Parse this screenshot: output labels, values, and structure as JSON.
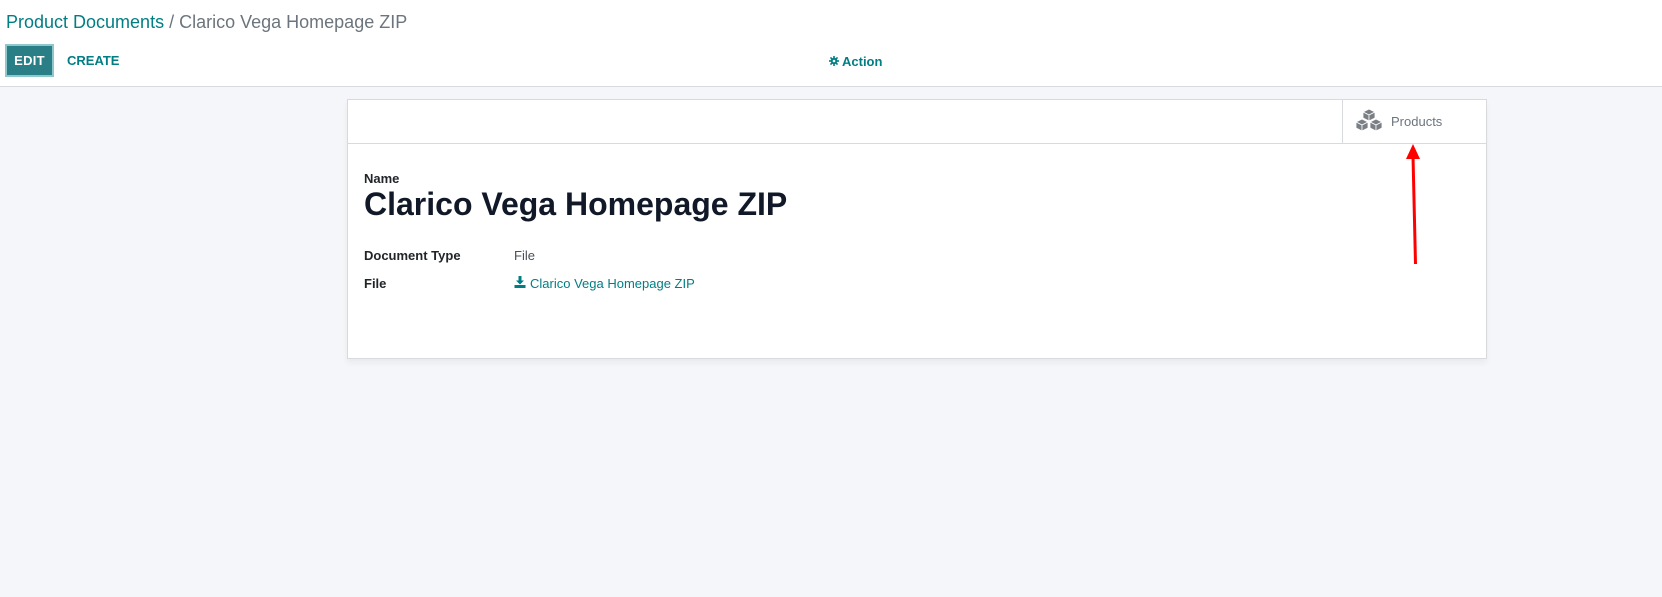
{
  "breadcrumb": {
    "parent": "Product Documents",
    "separator": " / ",
    "current": "Clarico Vega Homepage ZIP"
  },
  "toolbar": {
    "edit_label": "EDIT",
    "create_label": "CREATE",
    "action_label": "Action",
    "action_icon": "gear-icon"
  },
  "smart_button": {
    "label": "Products",
    "icon": "cubes-icon"
  },
  "form": {
    "name_label": "Name",
    "name_value": "Clarico Vega Homepage ZIP",
    "fields": [
      {
        "label": "Document Type",
        "value": "File"
      },
      {
        "label": "File",
        "value": "Clarico Vega Homepage ZIP",
        "icon": "download-icon"
      }
    ]
  },
  "colors": {
    "primary": "#017e84",
    "edit_button": "#2a7f86",
    "annotation_arrow": "#ff0000",
    "background": "#f4f6f9"
  }
}
